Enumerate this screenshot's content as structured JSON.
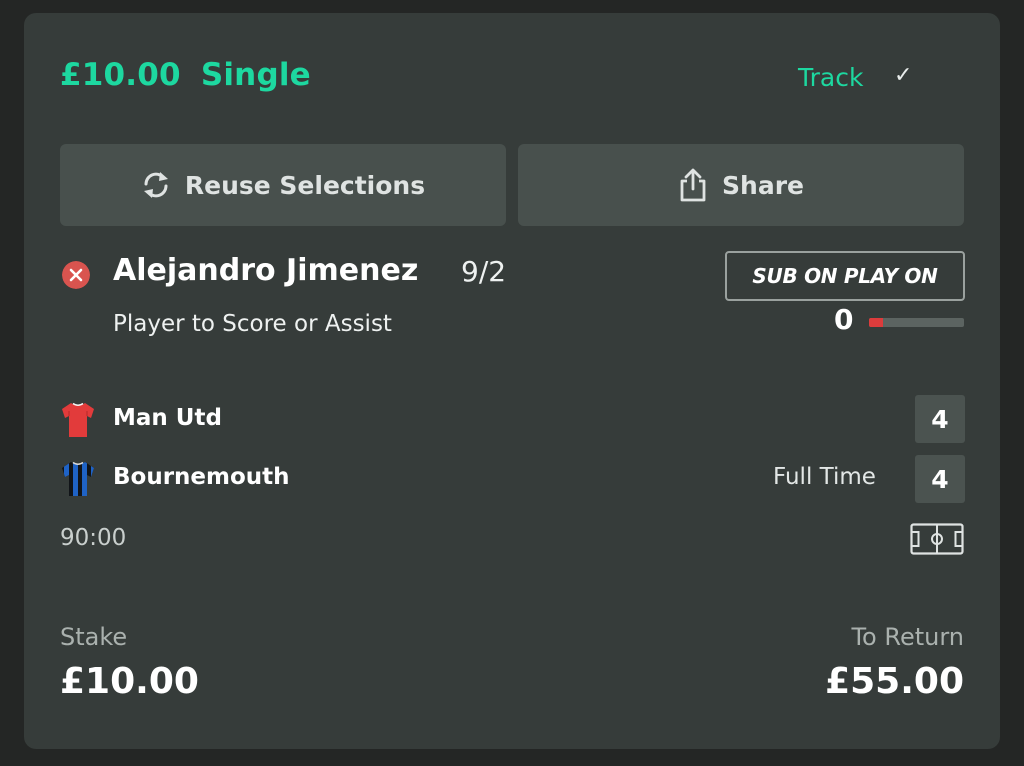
{
  "bet": {
    "stake_amount": "£10.00",
    "bet_type": "Single",
    "track_label": "Track",
    "track_status": "✓"
  },
  "actions": {
    "reuse_label": "Reuse Selections",
    "share_label": "Share"
  },
  "selection": {
    "name": "Alejandro Jimenez",
    "odds": "9/2",
    "market": "Player to Score or Assist",
    "status": "lost",
    "status_icon": "close-icon",
    "badge": "SUB ON PLAY ON",
    "progress_count": "0",
    "progress_fraction": 0.15
  },
  "match": {
    "home_team": "Man Utd",
    "home_score": "4",
    "home_kit_icon": "kit-red-icon",
    "away_team": "Bournemouth",
    "away_score": "4",
    "away_kit_icon": "kit-striped-blue-black-icon",
    "status": "Full Time",
    "clock": "90:00",
    "pitch_icon": "pitch-icon"
  },
  "footer": {
    "stake_label": "Stake",
    "stake_value": "£10.00",
    "return_label": "To Return",
    "return_value": "£55.00"
  },
  "colors": {
    "accent": "#1dd8a0",
    "card_background": "#363c3a",
    "button_background": "#48504d",
    "loss_red": "#d9544f",
    "home_kit": "#e23b3b",
    "away_kit_blue": "#1f63c6"
  }
}
